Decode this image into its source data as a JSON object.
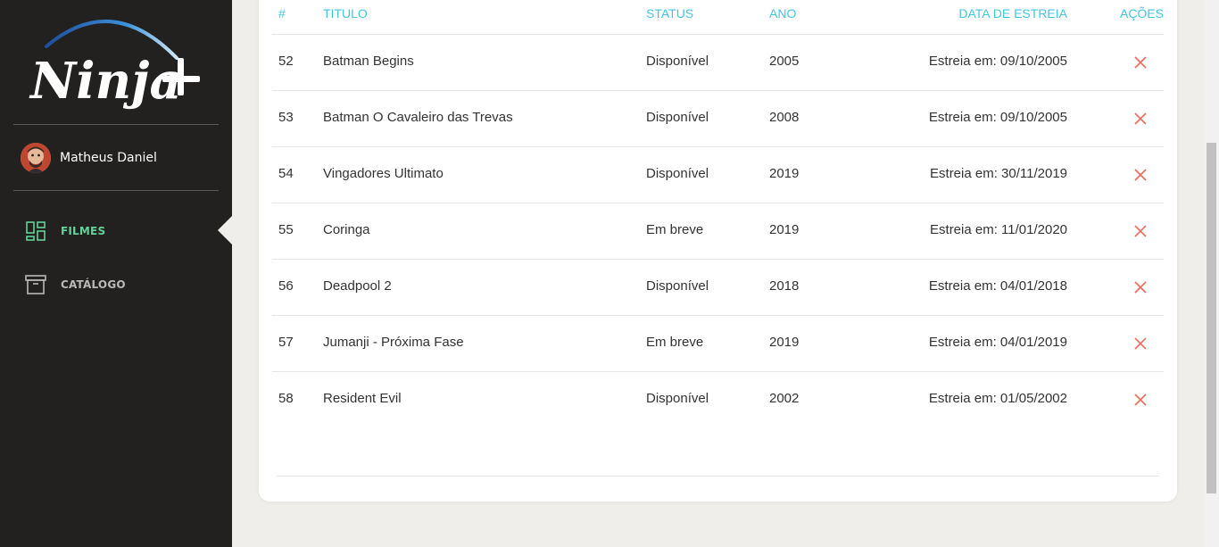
{
  "app": {
    "logo_text": "Ninja+"
  },
  "user": {
    "name": "Matheus Daniel"
  },
  "nav": {
    "items": [
      {
        "label": "FILMES",
        "icon": "dashboard-icon",
        "active": true
      },
      {
        "label": "CATÁLOGO",
        "icon": "archive-box-icon",
        "active": false
      }
    ]
  },
  "table": {
    "headers": {
      "id": "#",
      "title": "TITULO",
      "status": "STATUS",
      "year": "ANO",
      "release": "DATA DE ESTREIA",
      "actions": "AÇÕES"
    },
    "rows": [
      {
        "id": "52",
        "title": "Batman Begins",
        "status": "Disponível",
        "year": "2005",
        "release": "Estreia em: 09/10/2005"
      },
      {
        "id": "53",
        "title": "Batman O Cavaleiro das Trevas",
        "status": "Disponível",
        "year": "2008",
        "release": "Estreia em: 09/10/2005"
      },
      {
        "id": "54",
        "title": "Vingadores Ultimato",
        "status": "Disponível",
        "year": "2019",
        "release": "Estreia em: 30/11/2019"
      },
      {
        "id": "55",
        "title": "Coringa",
        "status": "Em breve",
        "year": "2019",
        "release": "Estreia em: 11/01/2020"
      },
      {
        "id": "56",
        "title": "Deadpool 2",
        "status": "Disponível",
        "year": "2018",
        "release": "Estreia em: 04/01/2018"
      },
      {
        "id": "57",
        "title": "Jumanji - Próxima Fase",
        "status": "Em breve",
        "year": "2019",
        "release": "Estreia em: 04/01/2019"
      },
      {
        "id": "58",
        "title": "Resident Evil",
        "status": "Disponível",
        "year": "2002",
        "release": "Estreia em: 01/05/2002"
      }
    ]
  },
  "colors": {
    "sidebar_bg": "#222120",
    "page_bg": "#efeeea",
    "header_accent": "#41c6e0",
    "nav_active": "#5fd39a",
    "nav_inactive": "#b9b9b9",
    "delete_icon": "#e86b5d"
  }
}
